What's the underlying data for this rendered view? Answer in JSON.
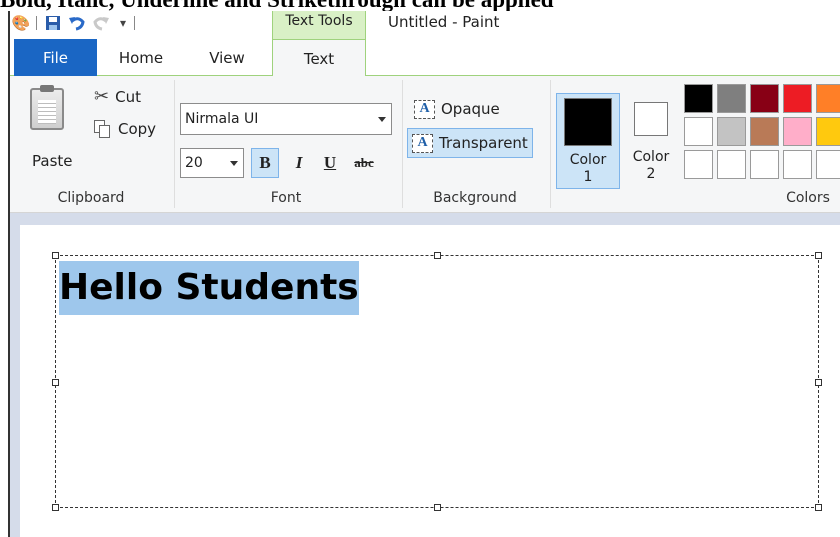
{
  "caption": "Bold, Italic, Underline and Strikethrough can be applied",
  "titlebar": {
    "context_tab": "Text Tools",
    "window_title": "Untitled - Paint"
  },
  "tabs": {
    "file": "File",
    "home": "Home",
    "view": "View",
    "text": "Text"
  },
  "clipboard": {
    "paste": "Paste",
    "cut": "Cut",
    "copy": "Copy",
    "group": "Clipboard"
  },
  "font": {
    "family": "Nirmala UI",
    "size": "20",
    "bold": "B",
    "italic": "I",
    "underline": "U",
    "strike": "abc",
    "group": "Font"
  },
  "background": {
    "opaque": "Opaque",
    "transparent": "Transparent",
    "icon_letter": "A",
    "group": "Background"
  },
  "colors": {
    "color1_label": "Color",
    "color1_num": "1",
    "color2_label": "Color",
    "color2_num": "2",
    "color1_value": "#000000",
    "color2_value": "#ffffff",
    "group": "Colors",
    "palette": [
      "#000000",
      "#7f7f7f",
      "#880015",
      "#ed1c24",
      "#ff7f27",
      "#ffffff",
      "#c3c3c3",
      "#b97a57",
      "#ffaec9",
      "#ffc90e",
      "#ffffff",
      "#ffffff",
      "#ffffff",
      "#ffffff",
      "#ffffff"
    ]
  },
  "canvas": {
    "text": "Hello Students"
  }
}
